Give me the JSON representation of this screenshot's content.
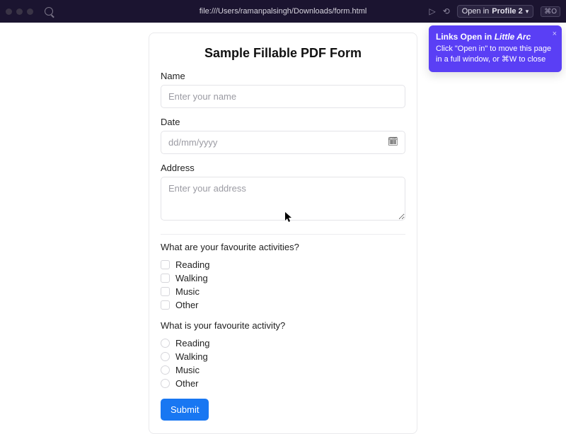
{
  "browser": {
    "url": "file:///Users/ramanpalsingh/Downloads/form.html",
    "profile_label": "Open in",
    "profile_name": "Profile 2",
    "xo_label": "⌘O"
  },
  "tooltip": {
    "title_prefix": "Links Open in ",
    "title_em": "Little Arc",
    "body": "Click \"Open in\" to move this page in a full window, or ⌘W to close"
  },
  "form": {
    "title": "Sample Fillable PDF Form",
    "name_label": "Name",
    "name_placeholder": "Enter your name",
    "date_label": "Date",
    "date_placeholder": "dd/mm/yyyy",
    "address_label": "Address",
    "address_placeholder": "Enter your address",
    "q_multi": "What are your favourite activities?",
    "q_single": "What is your favourite activity?",
    "options": [
      "Reading",
      "Walking",
      "Music",
      "Other"
    ],
    "submit_label": "Submit"
  }
}
